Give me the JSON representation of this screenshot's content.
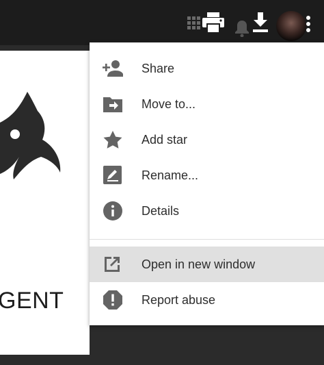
{
  "toolbar": {
    "apps_icon": "apps-grid-icon",
    "print_icon": "print-icon",
    "download_icon": "download-icon",
    "notifications_icon": "bell-icon",
    "avatar": "account-avatar",
    "more_icon": "more-vert-icon"
  },
  "document": {
    "visible_text": "GENT"
  },
  "menu": {
    "items": [
      {
        "label": "Share",
        "icon": "person-add-icon"
      },
      {
        "label": "Move to...",
        "icon": "folder-move-icon"
      },
      {
        "label": "Add star",
        "icon": "star-icon"
      },
      {
        "label": "Rename...",
        "icon": "rename-icon"
      },
      {
        "label": "Details",
        "icon": "info-icon"
      },
      {
        "label": "Open in new window",
        "icon": "open-in-new-icon",
        "highlighted": true
      },
      {
        "label": "Report abuse",
        "icon": "report-icon"
      }
    ]
  },
  "colors": {
    "toolbar_bg": "#1c1c1c",
    "page_bg": "#2b2b2b",
    "menu_bg": "#ffffff",
    "highlight_bg": "#e0e0e0",
    "icon_color": "#646464",
    "text_color": "#2d2d2d"
  }
}
